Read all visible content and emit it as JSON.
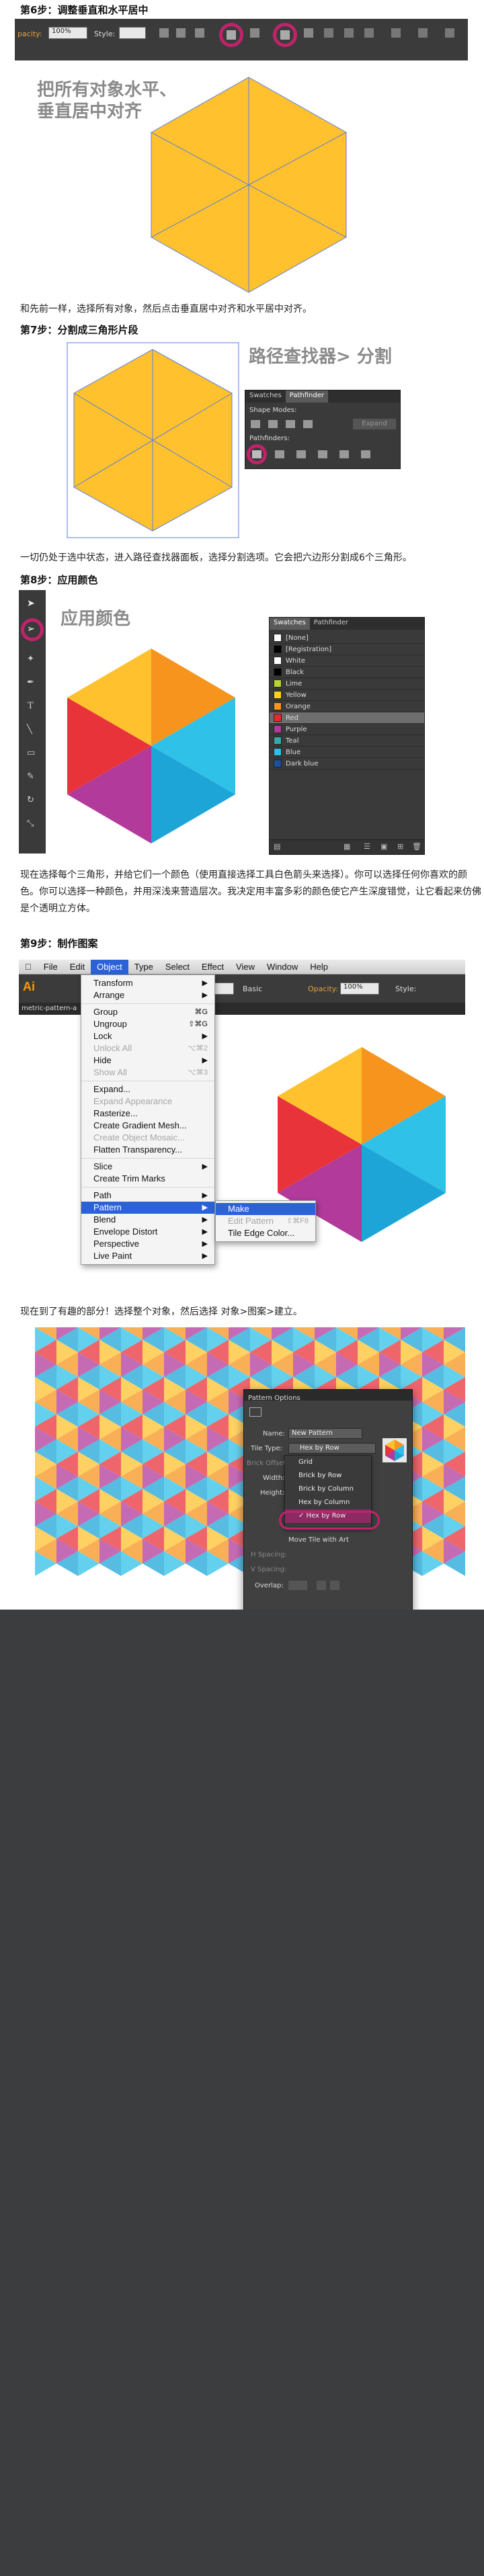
{
  "steps": {
    "step6": {
      "title": "第6步：调整垂直和水平居中",
      "note": "把所有对象水平、\n垂直居中对齐",
      "caption": "和先前一样，选择所有对象，然后点击垂直居中对齐和水平居中对齐。"
    },
    "step7": {
      "title": "第7步：分割成三角形片段",
      "note": "路径查找器> 分割",
      "caption": "一切仍处于选中状态，进入路径查找器面板，选择分割选项。它会把六边形分割成6个三角形。"
    },
    "step8": {
      "title": "第8步：应用颜色",
      "note": "应用颜色",
      "caption": "现在选择每个三角形，并给它们一个颜色（使用直接选择工具白色箭头来选择）。你可以选择任何你喜欢的颜色。你可以选择一种颜色，并用深浅来营造层次。我决定用丰富多彩的颜色使它产生深度错觉，让它看起来仿佛是个透明立方体。"
    },
    "step9": {
      "title": "第9步：制作图案",
      "caption": "现在到了有趣的部分！选择整个对象，然后选择 对象>图案>建立。"
    }
  },
  "toolbar6": {
    "opacity_label": "pacity:",
    "opacity_value": "100%",
    "style_label": "Style:"
  },
  "pathfinder": {
    "tabs": [
      "Swatches",
      "Pathfinder"
    ],
    "shape_modes": "Shape Modes:",
    "pathfinders": "Pathfinders:",
    "expand": "Expand"
  },
  "swatches": {
    "tabs": [
      "Swatches",
      "Pathfinder"
    ],
    "items": [
      {
        "name": "[None]",
        "color": "#ffffff"
      },
      {
        "name": "[Registration]",
        "color": "#000000"
      },
      {
        "name": "White",
        "color": "#ffffff"
      },
      {
        "name": "Black",
        "color": "#000000"
      },
      {
        "name": "Lime",
        "color": "#b6d433"
      },
      {
        "name": "Yellow",
        "color": "#ffd21e"
      },
      {
        "name": "Orange",
        "color": "#f7941d"
      },
      {
        "name": "Red",
        "color": "#e8282b"
      },
      {
        "name": "Purple",
        "color": "#b13a9b"
      },
      {
        "name": "Teal",
        "color": "#3aa8a8"
      },
      {
        "name": "Blue",
        "color": "#29c0ea"
      },
      {
        "name": "Dark blue",
        "color": "#1b4fa0"
      }
    ],
    "selected_index": 7
  },
  "menubar": {
    "app": "Illustrator",
    "items": [
      "File",
      "Edit",
      "Object",
      "Type",
      "Select",
      "Effect",
      "View",
      "Window",
      "Help"
    ],
    "active": "Object",
    "doc_tab": "metric-pattern-a",
    "ai": "Ai",
    "opacity_label": "Opacity:",
    "opacity_value": "100%",
    "style_label": "Style:",
    "basic": "Basic"
  },
  "object_menu": [
    {
      "label": "Transform",
      "sub": true
    },
    {
      "label": "Arrange",
      "sub": true
    },
    {
      "sep": true
    },
    {
      "label": "Group",
      "sc": "⌘G"
    },
    {
      "label": "Ungroup",
      "sc": "⇧⌘G"
    },
    {
      "label": "Lock",
      "sub": true
    },
    {
      "label": "Unlock All",
      "sc": "⌥⌘2",
      "disabled": true
    },
    {
      "label": "Hide",
      "sub": true
    },
    {
      "label": "Show All",
      "sc": "⌥⌘3",
      "disabled": true
    },
    {
      "sep": true
    },
    {
      "label": "Expand..."
    },
    {
      "label": "Expand Appearance",
      "disabled": true
    },
    {
      "label": "Rasterize..."
    },
    {
      "label": "Create Gradient Mesh..."
    },
    {
      "label": "Create Object Mosaic...",
      "disabled": true
    },
    {
      "label": "Flatten Transparency..."
    },
    {
      "sep": true
    },
    {
      "label": "Slice",
      "sub": true
    },
    {
      "label": "Create Trim Marks"
    },
    {
      "sep": true
    },
    {
      "label": "Path",
      "sub": true
    },
    {
      "label": "Pattern",
      "sub": true,
      "active": true
    },
    {
      "label": "Blend",
      "sub": true
    },
    {
      "label": "Envelope Distort",
      "sub": true
    },
    {
      "label": "Perspective",
      "sub": true
    },
    {
      "label": "Live Paint",
      "sub": true
    }
  ],
  "pattern_submenu": [
    {
      "label": "Make",
      "active": true
    },
    {
      "label": "Edit Pattern",
      "sc": "⇧⌘F8",
      "disabled": true
    },
    {
      "label": "Tile Edge Color..."
    }
  ],
  "pattern_options": {
    "title": "Pattern Options",
    "name_label": "Name:",
    "name_value": "New Pattern",
    "tile_type_label": "Tile Type:",
    "tile_type_value": "Hex by Row",
    "brick_offset_label": "Brick Offset:",
    "width_label": "Width:",
    "height_label": "Height:",
    "h_spacing_label": "H Spacing:",
    "v_spacing_label": "V Spacing:",
    "overlap_label": "Overlap:",
    "move_tile": "Move Tile with Art",
    "options": [
      "Grid",
      "Brick by Row",
      "Brick by Column",
      "Hex by Column",
      "Hex by Row"
    ],
    "selected_option": "Hex by Row"
  },
  "colors": {
    "hex_yellow": "#FFC22E",
    "orange": "#F7941D",
    "red": "#E8333A",
    "blue": "#2FC1E8",
    "purple": "#B13A9B",
    "yellow": "#FFD21E",
    "accent": "#C0236B",
    "dark_bg": "#3B3D3E"
  }
}
